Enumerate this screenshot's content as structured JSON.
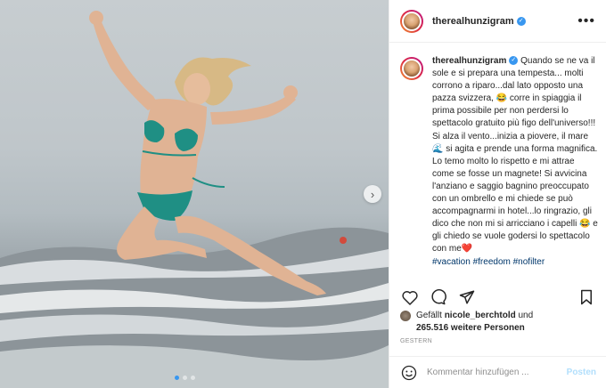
{
  "post": {
    "username": "therealhunzigram",
    "more_icon": "more-options-icon",
    "caption": {
      "username": "therealhunzigram",
      "body": "Quando se ne va il sole e si prepara una tempesta... molti corrono a riparo...dal lato opposto una pazza svizzera, 😂 corre in spiaggia il prima possibile per non perdersi lo spettacolo gratuito più figo dell'universo!!! Si alza il vento...inizia a piovere, il mare 🌊 si agita e prende una forma magnifica. Lo temo molto lo rispetto e mi attrae come se fosse un magnete! Si avvicina l'anziano e saggio bagnino preoccupato con un ombrello e mi chiede se può accompagnarmi in hotel...lo ringrazio, gli dico che non mi si arricciano i capelli 😂 e gli chiedo se vuole godersi lo spettacolo con me❤️",
      "hashtags": "#vacation #freedom #nofilter"
    },
    "likes": {
      "prefix": "Gefällt",
      "liker": "nicole_berchtold",
      "conj": "und",
      "count_text": "265.516 weitere Personen"
    },
    "date": "GESTERN",
    "comment": {
      "placeholder": "Kommentar hinzufügen ...",
      "post_label": "Posten"
    }
  },
  "colors": {
    "verified": "#3897f0",
    "bikini": "#1f8f84",
    "link": "#00376b"
  }
}
